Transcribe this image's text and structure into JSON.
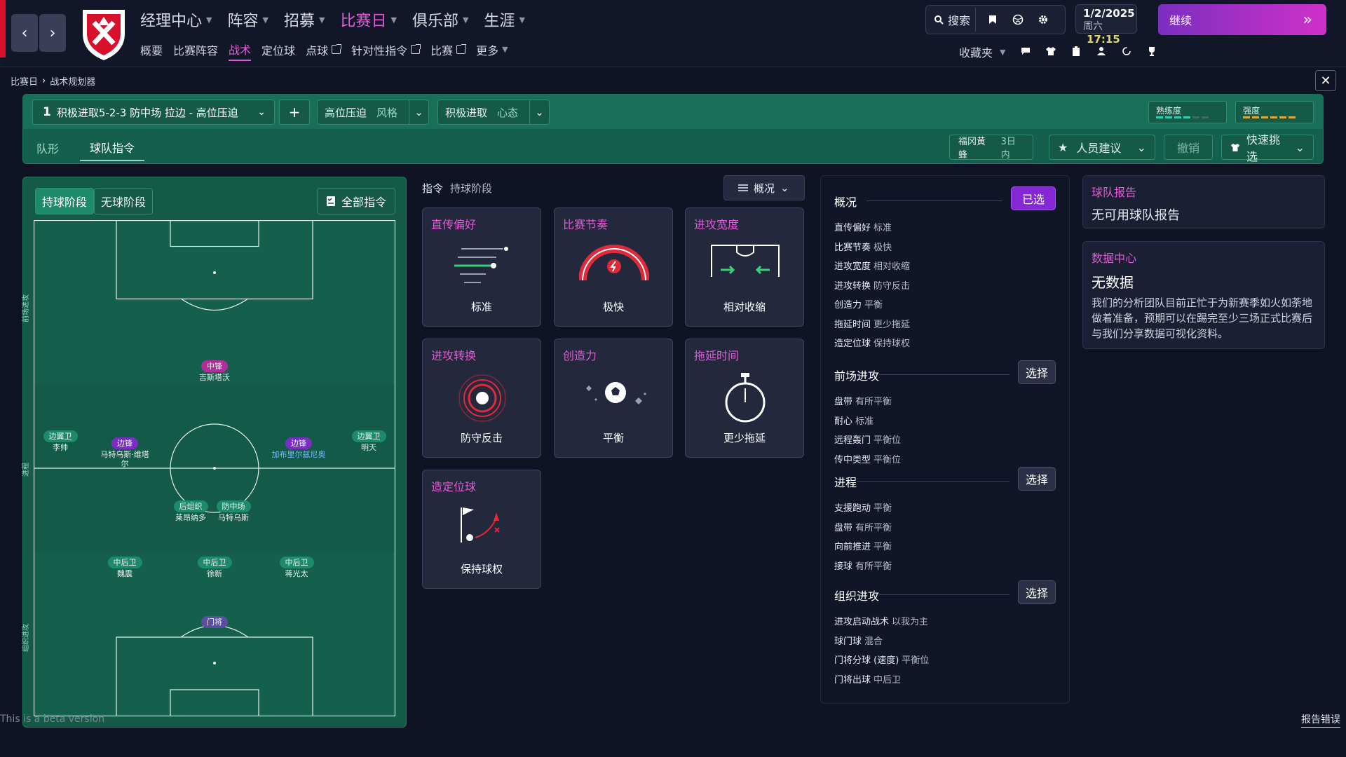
{
  "nav": {
    "main": [
      {
        "label": "经理中心",
        "active": false
      },
      {
        "label": "阵容",
        "active": false
      },
      {
        "label": "招募",
        "active": false
      },
      {
        "label": "比赛日",
        "active": true
      },
      {
        "label": "俱乐部",
        "active": false
      },
      {
        "label": "生涯",
        "active": false
      }
    ],
    "sub": [
      {
        "label": "概要",
        "ext": false,
        "active": false
      },
      {
        "label": "比赛阵容",
        "ext": false,
        "active": false
      },
      {
        "label": "战术",
        "ext": false,
        "active": true
      },
      {
        "label": "定位球",
        "ext": false,
        "active": false
      },
      {
        "label": "点球",
        "ext": true,
        "active": false
      },
      {
        "label": "针对性指令",
        "ext": true,
        "active": false
      },
      {
        "label": "比赛",
        "ext": true,
        "active": false
      },
      {
        "label": "更多",
        "ext": false,
        "active": false
      }
    ],
    "search_label": "搜索",
    "favorites_label": "收藏夹"
  },
  "date": {
    "date": "1/2/2025",
    "weekday": "周六",
    "time": "17:15"
  },
  "continue_label": "继续",
  "breadcrumb": {
    "root": "比赛日",
    "current": "战术规划器"
  },
  "tactic": {
    "number": "1",
    "name": "积极进取5-2-3 防中场 拉边 - 高位压迫",
    "style_value": "高位压迫",
    "style_label": "风格",
    "mentality_value": "积极进取",
    "mentality_label": "心态",
    "familiarity_label": "熟练度",
    "intensity_label": "强度"
  },
  "subtabs": [
    "队形",
    "球队指令"
  ],
  "opponent": {
    "name": "福冈黄蜂",
    "when": "3日内"
  },
  "actions": {
    "suggest": "人员建议",
    "undo": "撤销",
    "quickpick": "快速挑选"
  },
  "colors": {
    "accent": "#e15bd5",
    "green_panel": "#14604c",
    "purple": "#8428d6"
  },
  "pitch": {
    "phase_in": "持球阶段",
    "phase_out": "无球阶段",
    "all_instructions": "全部指令",
    "zones": [
      "前场进攻",
      "进程",
      "组织进攻"
    ],
    "players": [
      {
        "role": "中锋",
        "name": "吉斯塔沃",
        "color": "pink"
      },
      {
        "role": "边翼卫",
        "name": "李帅",
        "color": "green"
      },
      {
        "role": "边锋",
        "name": "马特乌斯·维塔尔",
        "color": "purple"
      },
      {
        "role": "边锋",
        "name": "加布里尔兹尼奥",
        "color": "purple"
      },
      {
        "role": "边翼卫",
        "name": "明天",
        "color": "green"
      },
      {
        "role": "后组织",
        "name": "莱昂纳多",
        "color": "green"
      },
      {
        "role": "防中场",
        "name": "马特乌斯",
        "color": "green"
      },
      {
        "role": "中后卫",
        "name": "魏震",
        "color": "green"
      },
      {
        "role": "中后卫",
        "name": "徐新",
        "color": "green"
      },
      {
        "role": "中后卫",
        "name": "蒋光太",
        "color": "green"
      },
      {
        "role": "门将",
        "name": "",
        "color": "gk"
      }
    ]
  },
  "instructions": {
    "title": "指令",
    "phase": "持球阶段",
    "overview_dd": "概况",
    "cards": [
      {
        "title": "直传偏好",
        "value": "标准",
        "icon": "passing-icon"
      },
      {
        "title": "比赛节奏",
        "value": "极快",
        "icon": "tempo-gauge-icon"
      },
      {
        "title": "进攻宽度",
        "value": "相对收缩",
        "icon": "width-goal-icon"
      },
      {
        "title": "进攻转换",
        "value": "防守反击",
        "icon": "target-icon"
      },
      {
        "title": "创造力",
        "value": "平衡",
        "icon": "ball-sparkle-icon"
      },
      {
        "title": "拖延时间",
        "value": "更少拖延",
        "icon": "stopwatch-icon"
      },
      {
        "title": "造定位球",
        "value": "保持球权",
        "icon": "corner-flag-icon"
      }
    ]
  },
  "summary": {
    "overview": {
      "title": "概况",
      "button": "已选",
      "rows": [
        {
          "k": "直传偏好",
          "v": "标准"
        },
        {
          "k": "比赛节奏",
          "v": "极快"
        },
        {
          "k": "进攻宽度",
          "v": "相对收缩"
        },
        {
          "k": "进攻转换",
          "v": "防守反击"
        },
        {
          "k": "创造力",
          "v": "平衡"
        },
        {
          "k": "拖延时间",
          "v": "更少拖延"
        },
        {
          "k": "造定位球",
          "v": "保持球权"
        }
      ]
    },
    "final_third": {
      "title": "前场进攻",
      "button": "选择",
      "rows": [
        {
          "k": "盘带",
          "v": "有所平衡"
        },
        {
          "k": "耐心",
          "v": "标准"
        },
        {
          "k": "远程轰门",
          "v": "平衡位"
        },
        {
          "k": "传中类型",
          "v": "平衡位"
        }
      ]
    },
    "progression": {
      "title": "进程",
      "button": "选择",
      "rows": [
        {
          "k": "支援跑动",
          "v": "平衡"
        },
        {
          "k": "盘带",
          "v": "有所平衡"
        },
        {
          "k": "向前推进",
          "v": "平衡"
        },
        {
          "k": "接球",
          "v": "有所平衡"
        }
      ]
    },
    "buildup": {
      "title": "组织进攻",
      "button": "选择",
      "rows": [
        {
          "k": "进攻启动战术",
          "v": "以我为主"
        },
        {
          "k": "球门球",
          "v": "混合"
        },
        {
          "k": "门将分球 (速度)",
          "v": "平衡位"
        },
        {
          "k": "门将出球",
          "v": "中后卫"
        }
      ]
    }
  },
  "team_report": {
    "title": "球队报告",
    "text": "无可用球队报告"
  },
  "data_hub": {
    "title": "数据中心",
    "heading": "无数据",
    "text": "我们的分析团队目前正忙于为新赛季如火如荼地做着准备，预期可以在踢完至少三场正式比赛后与我们分享数据可视化资料。"
  },
  "beta_text": "This is a beta version",
  "report_bug": "报告错误"
}
